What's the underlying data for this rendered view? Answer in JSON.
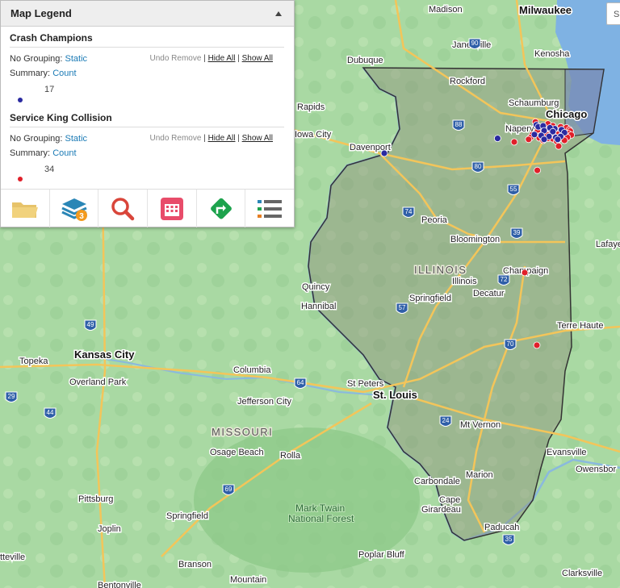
{
  "legend": {
    "title": "Map Legend",
    "layers": [
      {
        "name": "Crash Champions",
        "grouping_label": "No Grouping:",
        "grouping_value": "Static",
        "summary_label": "Summary:",
        "summary_value": "Count",
        "undo": "Undo Remove",
        "hide_all": "Hide All",
        "show_all": "Show All",
        "count": "17",
        "color": "#2a2aa0"
      },
      {
        "name": "Service King Collision",
        "grouping_label": "No Grouping:",
        "grouping_value": "Static",
        "summary_label": "Summary:",
        "summary_value": "Count",
        "undo": "Undo Remove",
        "hide_all": "Hide All",
        "show_all": "Show All",
        "count": "34",
        "color": "#e0202a"
      }
    ],
    "toolbar": {
      "layers_badge": "3",
      "icons": [
        "folder-icon",
        "layers-icon",
        "search-icon",
        "calendar-icon",
        "directions-icon",
        "list-icon"
      ]
    }
  },
  "search_box_text": "S",
  "map": {
    "state_labels": {
      "illinois": "ILLINOIS",
      "missouri": "MISSOURI"
    },
    "park_labels": [
      "Mark Twain",
      "National Forest"
    ],
    "cities": {
      "madison": "Madison",
      "milwaukee": "Milwaukee",
      "janesville": "Janesville",
      "kenosha": "Kenosha",
      "dubuque": "Dubuque",
      "rockford": "Rockford",
      "rapids": "Rapids",
      "schaumburg": "Schaumburg",
      "chicago": "Chicago",
      "naperville": "Naperville",
      "iowa_city": "Iowa City",
      "davenport": "Davenport",
      "peoria": "Peoria",
      "bloomington": "Bloomington",
      "champaign": "Champaign",
      "illinois_city": "Illinois",
      "decatur": "Decatur",
      "springfield_il": "Springfield",
      "quincy": "Quincy",
      "hannibal": "Hannibal",
      "terre_haute": "Terre Haute",
      "lafayette": "Lafaye",
      "topeka": "Topeka",
      "kansas_city": "Kansas City",
      "overland_park": "Overland Park",
      "columbia": "Columbia",
      "jefferson_city": "Jefferson City",
      "st_peters": "St Peters",
      "st_louis": "St. Louis",
      "mt_vernon": "Mt Vernon",
      "evansville": "Evansville",
      "owensboro": "Owensbor",
      "osage_beach": "Osage Beach",
      "rolla": "Rolla",
      "marion": "Marion",
      "carbondale": "Carbondale",
      "cape_girardeau_1": "Cape",
      "cape_girardeau_2": "Girardeau",
      "pittsburg": "Pittsburg",
      "springfield_mo": "Springfield",
      "joplin": "Joplin",
      "paducah": "Paducah",
      "poplar_bluff": "Poplar Bluff",
      "branson": "Branson",
      "clarksville": "Clarksville",
      "mountain": "Mountain",
      "bentonville": "Bentonville",
      "fayetteville": "tteville"
    },
    "highway_shields": [
      "90",
      "88",
      "80",
      "74",
      "55",
      "39",
      "72",
      "57",
      "70",
      "64",
      "24",
      "35",
      "29",
      "49",
      "44",
      "69"
    ],
    "crash_champions_points": [
      [
        1.6,
        -0.2
      ],
      [
        -0.3,
        -0.6
      ],
      [
        -0.1,
        -0.4
      ],
      [
        0.4,
        -0.5
      ],
      [
        1.1,
        -0.3
      ],
      [
        2.3,
        -0.1
      ],
      [
        0.5,
        0.0
      ],
      [
        1.4,
        0.1
      ],
      [
        2.6,
        0.2
      ],
      [
        -0.5,
        0.4
      ],
      [
        0.2,
        0.5
      ],
      [
        1.0,
        0.6
      ],
      [
        1.7,
        0.7
      ],
      [
        2.2,
        0.6
      ],
      [
        0.5,
        0.9
      ],
      [
        -4.3,
        0.8
      ],
      [
        1.9,
        0.9
      ]
    ],
    "service_king_points": [
      [
        -0.4,
        -0.9
      ],
      [
        0.9,
        -0.7
      ],
      [
        1.4,
        -0.5
      ],
      [
        2.2,
        -0.4
      ],
      [
        2.8,
        -0.3
      ],
      [
        3.1,
        -0.1
      ],
      [
        0.2,
        -0.3
      ],
      [
        0.9,
        -0.1
      ],
      [
        1.8,
        -0.05
      ],
      [
        2.4,
        0.1
      ],
      [
        3.2,
        0.05
      ],
      [
        -0.2,
        0.1
      ],
      [
        0.6,
        0.2
      ],
      [
        1.2,
        0.3
      ],
      [
        2.0,
        0.35
      ],
      [
        3.0,
        0.3
      ],
      [
        -0.7,
        0.4
      ],
      [
        0.1,
        0.5
      ],
      [
        0.8,
        0.45
      ],
      [
        1.5,
        0.55
      ],
      [
        2.3,
        0.5
      ],
      [
        3.3,
        0.45
      ],
      [
        -0.9,
        0.7
      ],
      [
        0.0,
        0.75
      ],
      [
        0.9,
        0.8
      ],
      [
        1.4,
        0.85
      ],
      [
        2.1,
        0.8
      ],
      [
        2.9,
        0.7
      ],
      [
        1.8,
        1.1
      ],
      [
        0.4,
        1.0
      ],
      [
        2.6,
        1.0
      ],
      [
        -1.1,
        0.9
      ],
      [
        2.0,
        1.6
      ],
      [
        -0.2,
        4.1
      ]
    ]
  }
}
